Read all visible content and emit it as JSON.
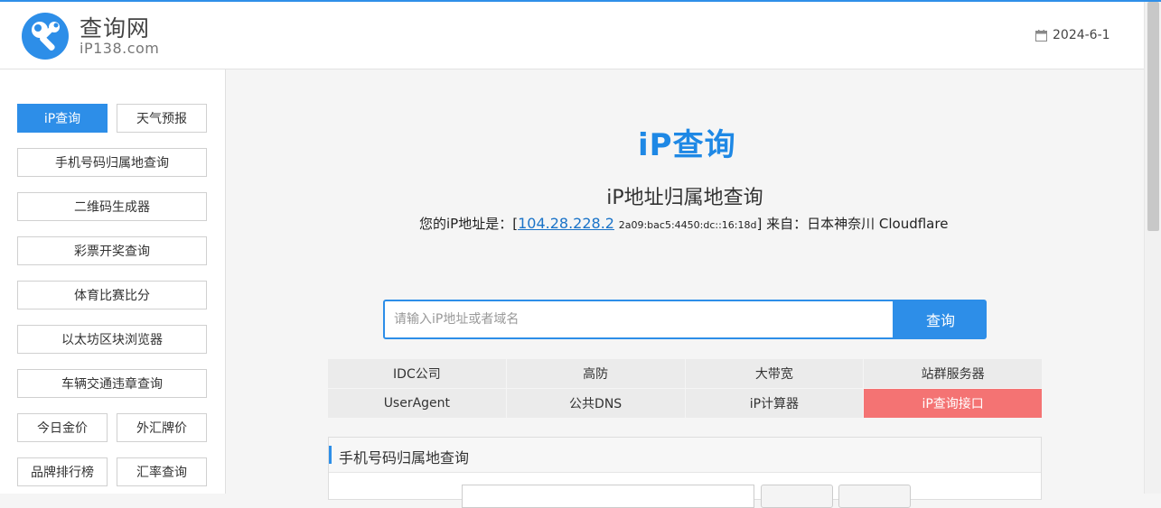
{
  "site": {
    "title": "查询网",
    "subtitle": "iP138.com",
    "date": "2024-6-1"
  },
  "sidebar": {
    "items": [
      {
        "label": "iP查询",
        "active": true
      },
      {
        "label": "天气预报"
      },
      {
        "label": "手机号码归属地查询"
      },
      {
        "label": "二维码生成器"
      },
      {
        "label": "彩票开奖查询"
      },
      {
        "label": "体育比赛比分"
      },
      {
        "label": "以太坊区块浏览器"
      },
      {
        "label": "车辆交通违章查询"
      },
      {
        "label": "今日金价"
      },
      {
        "label": "外汇牌价"
      },
      {
        "label": "品牌排行榜"
      },
      {
        "label": "汇率查询"
      }
    ]
  },
  "main": {
    "brand": "iP查询",
    "page_title": "iP地址归属地查询",
    "ip_prefix": "您的iP地址是：[",
    "ipv4": "104.28.228.2",
    "ipv6": "2a09:bac5:4450:dc::16:18d",
    "ip_suffix": "] 来自：日本神奈川 Cloudflare",
    "search_placeholder": "请输入iP地址或者域名",
    "search_button": "查询",
    "links": [
      [
        "IDC公司",
        "高防",
        "大带宽",
        "站群服务器"
      ],
      [
        "UserAgent",
        "公共DNS",
        "iP计算器",
        "iP查询接口"
      ]
    ],
    "panel_title": "手机号码归属地查询"
  },
  "colors": {
    "accent": "#2d8ee8",
    "hot": "#f47373"
  }
}
